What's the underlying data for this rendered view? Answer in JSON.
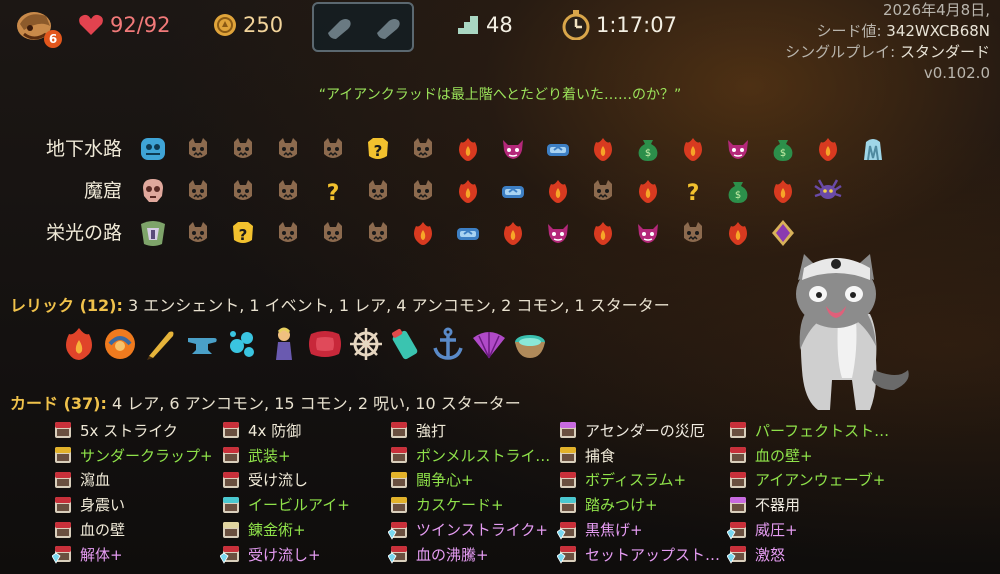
{
  "top_bar": {
    "floor_badge": "6",
    "hp": "92/92",
    "gold": "250",
    "floor": "48",
    "time": "1:17:07"
  },
  "seed_panel": {
    "date": "2026年4月8日,",
    "seed_label": "シード値: ",
    "seed_value": "342WXCB68N",
    "mode_label": "シングルプレイ: ",
    "mode_value": "スタンダード",
    "version": "v0.102.0"
  },
  "quote": "“アイアンクラッドは最上階へとたどり着いた……のか？”",
  "acts": [
    {
      "label": "地下水路",
      "nodes": [
        "boss-hydra",
        "monster",
        "monster",
        "monster",
        "monster",
        "unknown-gold",
        "monster",
        "elite",
        "event-demon",
        "rest",
        "elite",
        "treasure",
        "elite",
        "event-demon",
        "treasure",
        "elite",
        "boss-ice"
      ]
    },
    {
      "label": "魔窟",
      "nodes": [
        "boss-skull",
        "monster",
        "monster",
        "monster",
        "unknown",
        "monster",
        "monster",
        "elite",
        "rest",
        "elite",
        "monster",
        "elite",
        "unknown",
        "treasure",
        "elite",
        "boss-spider"
      ]
    },
    {
      "label": "栄光の路",
      "nodes": [
        "boss-knight",
        "monster",
        "unknown-gold",
        "monster",
        "monster",
        "monster",
        "elite",
        "rest",
        "elite",
        "event-demon",
        "elite",
        "event-demon",
        "monster",
        "elite",
        "boss-gem"
      ]
    }
  ],
  "relics": {
    "title": "レリック (12):",
    "summary": "3 エンシェント, 1 イベント, 1 レア, 4 アンコモン, 2 コモン, 1 スターター",
    "icons": [
      "flame-relic",
      "orange-orb",
      "golden-quill",
      "anvil-relic",
      "blue-splash",
      "figurine",
      "red-pillow",
      "ships-wheel",
      "battery",
      "anchor",
      "purple-fan",
      "teal-bowl"
    ]
  },
  "cards": {
    "title": "カード (37):",
    "summary": "4 レア, 6 アンコモン, 15 コモン, 2 呪い, 10 スターター",
    "columns": [
      [
        {
          "label": "5x ストライク",
          "style": "normal",
          "icon": "red"
        },
        {
          "label": "サンダークラップ+",
          "style": "up",
          "icon": "yellow"
        },
        {
          "label": "瀉血",
          "style": "normal",
          "icon": "red"
        },
        {
          "label": "身震い",
          "style": "normal",
          "icon": "red"
        },
        {
          "label": "血の壁",
          "style": "normal",
          "icon": "red"
        },
        {
          "label": "解体+",
          "style": "pink",
          "icon": "gem"
        }
      ],
      [
        {
          "label": "4x 防御",
          "style": "normal",
          "icon": "red"
        },
        {
          "label": "武装+",
          "style": "up",
          "icon": "red"
        },
        {
          "label": "受け流し",
          "style": "normal",
          "icon": "red"
        },
        {
          "label": "イービルアイ+",
          "style": "up",
          "icon": "teal"
        },
        {
          "label": "錬金術+",
          "style": "up",
          "icon": "cream"
        },
        {
          "label": "受け流し+",
          "style": "pink",
          "icon": "gem"
        }
      ],
      [
        {
          "label": "強打",
          "style": "normal",
          "icon": "red"
        },
        {
          "label": "ポンメルストライク+",
          "style": "up",
          "icon": "red"
        },
        {
          "label": "闘争心+",
          "style": "up",
          "icon": "yellow"
        },
        {
          "label": "カスケード+",
          "style": "up",
          "icon": "yellow"
        },
        {
          "label": "ツインストライク+",
          "style": "pink",
          "icon": "gem"
        },
        {
          "label": "血の沸騰+",
          "style": "pink",
          "icon": "gem"
        }
      ],
      [
        {
          "label": "アセンダーの災厄",
          "style": "curse",
          "icon": "purple"
        },
        {
          "label": "捕食",
          "style": "normal",
          "icon": "yellow"
        },
        {
          "label": "ボディスラム+",
          "style": "up",
          "icon": "red"
        },
        {
          "label": "踏みつけ+",
          "style": "up",
          "icon": "teal"
        },
        {
          "label": "黒焦げ+",
          "style": "pink",
          "icon": "gem"
        },
        {
          "label": "セットアップストラ…",
          "style": "pink",
          "icon": "gem"
        }
      ],
      [
        {
          "label": "パーフェクトストラ…",
          "style": "up",
          "icon": "red"
        },
        {
          "label": "血の壁+",
          "style": "up",
          "icon": "red"
        },
        {
          "label": "アイアンウェーブ+",
          "style": "up",
          "icon": "red"
        },
        {
          "label": "不器用",
          "style": "curse",
          "icon": "purple"
        },
        {
          "label": "威圧+",
          "style": "pink",
          "icon": "gem"
        },
        {
          "label": "激怒",
          "style": "pink",
          "icon": "gem"
        }
      ]
    ]
  }
}
